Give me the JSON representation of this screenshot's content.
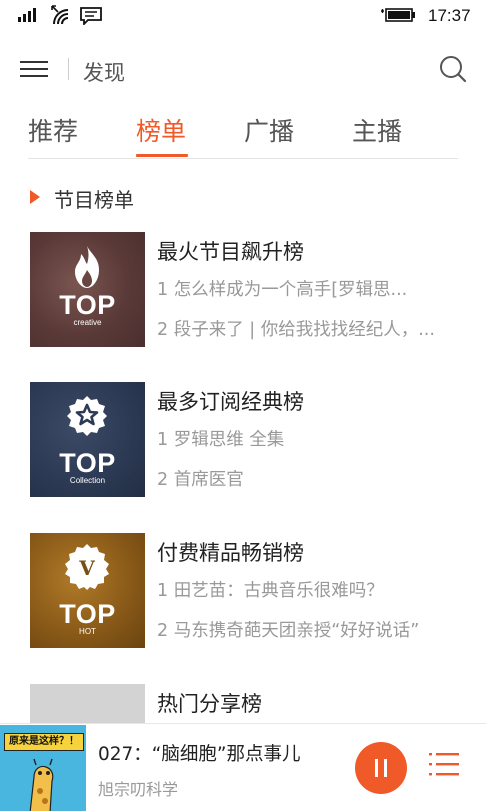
{
  "status_bar": {
    "time": "17:37"
  },
  "header": {
    "title": "发现",
    "menu_icon": "hamburger-menu-icon",
    "search_icon": "search-icon"
  },
  "tabs": [
    {
      "label": "推荐"
    },
    {
      "label": "榜单",
      "active": true
    },
    {
      "label": "广播"
    },
    {
      "label": "主播"
    }
  ],
  "section": {
    "title": "节目榜单"
  },
  "charts": [
    {
      "title": "最火节目飙升榜",
      "line1": "1 怎么样成为一个高手[罗辑思...",
      "line2": "2 段子来了 | 你给我找找经纪人，...",
      "cover": {
        "label": "TOP",
        "sub": "creative",
        "icon": "flame-icon"
      }
    },
    {
      "title": "最多订阅经典榜",
      "line1": "1 罗辑思维 全集",
      "line2": "2 首席医官",
      "cover": {
        "label": "TOP",
        "sub": "Collection",
        "icon": "star-badge-icon"
      }
    },
    {
      "title": "付费精品畅销榜",
      "line1": "1 田艺苗：古典音乐很难吗？",
      "line2": "2 马东携奇葩天团亲授“好好说话”",
      "cover": {
        "label": "TOP",
        "sub": "HOT",
        "icon": "v-badge-icon"
      }
    },
    {
      "title": "热门分享榜"
    }
  ],
  "player": {
    "title": "027：“脑细胞”那点事儿",
    "subtitle": "旭宗叨科学",
    "art_text": "原来是这样？！",
    "pause_icon": "pause-icon",
    "playlist_icon": "playlist-icon"
  },
  "colors": {
    "accent": "#f05a28",
    "muted": "#999999"
  }
}
